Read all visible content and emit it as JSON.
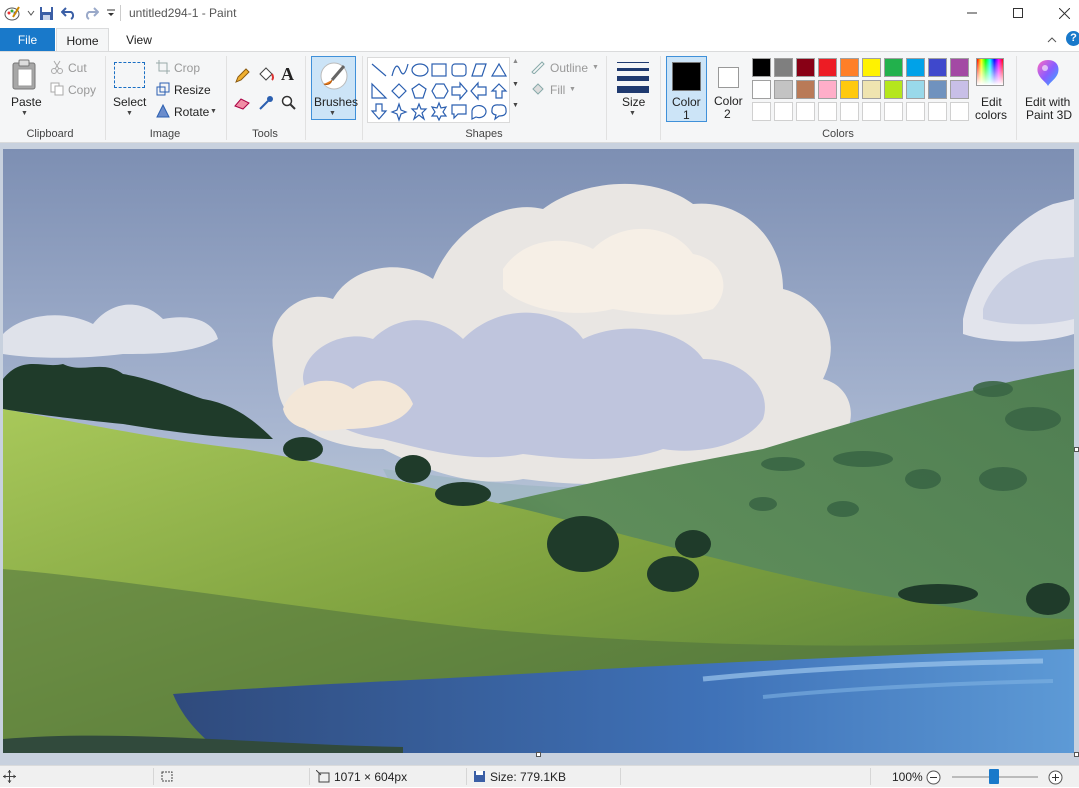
{
  "window": {
    "title": "untitled294-1 - Paint",
    "minimize_icon": "minimize-icon",
    "maximize_icon": "maximize-icon",
    "close_icon": "close-icon"
  },
  "tabs": {
    "file": "File",
    "home": "Home",
    "view": "View"
  },
  "clipboard": {
    "paste": "Paste",
    "cut": "Cut",
    "copy": "Copy",
    "group": "Clipboard"
  },
  "image": {
    "select": "Select",
    "crop": "Crop",
    "resize": "Resize",
    "rotate": "Rotate",
    "group": "Image"
  },
  "tools": {
    "group": "Tools"
  },
  "brushes": {
    "label": "Brushes"
  },
  "shapes": {
    "outline": "Outline",
    "fill": "Fill",
    "group": "Shapes"
  },
  "size": {
    "label": "Size"
  },
  "colors": {
    "color1_line1": "Color",
    "color1_line2": "1",
    "color2_line1": "Color",
    "color2_line2": "2",
    "edit_line1": "Edit",
    "edit_line2": "colors",
    "group": "Colors",
    "palette_row1": [
      "#000000",
      "#7f7f7f",
      "#880015",
      "#ed1c24",
      "#ff7f27",
      "#fff200",
      "#22b14c",
      "#00a2e8",
      "#3f48cc",
      "#a349a4"
    ],
    "palette_row2": [
      "#ffffff",
      "#c3c3c3",
      "#b97a57",
      "#ffaec9",
      "#ffc90e",
      "#efe4b0",
      "#b5e61d",
      "#99d9ea",
      "#7092be",
      "#c8bfe7"
    ],
    "color1": "#000000",
    "color2": "#ffffff"
  },
  "paint3d": {
    "line1": "Edit with",
    "line2": "Paint 3D"
  },
  "status": {
    "dimensions": "1071 × 604px",
    "size": "Size: 779.1KB",
    "zoom": "100%"
  }
}
